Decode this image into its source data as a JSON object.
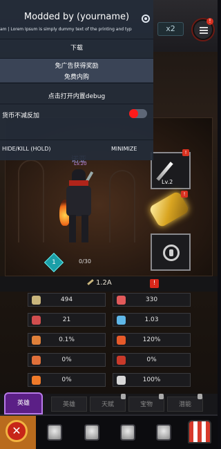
{
  "topbar": {
    "speed_label": "x2",
    "menu_badge": "!"
  },
  "hero": {
    "name": "诺亚",
    "level_tag": "Lv.20"
  },
  "stage": {
    "skill_points": "1",
    "progress": "0/30"
  },
  "equipment": {
    "weapon_level": "Lv.2",
    "weapon_badge": "!",
    "cannon_badge": "!"
  },
  "power": {
    "value": "1.2A",
    "warn_badge": "!"
  },
  "stats": [
    {
      "icon": "sword-icon",
      "value": "494"
    },
    {
      "icon": "heart-icon",
      "value": "330"
    },
    {
      "icon": "heart-shield-icon",
      "value": "21"
    },
    {
      "icon": "blue-sword-icon",
      "value": "1.03"
    },
    {
      "icon": "crit-icon",
      "value": "0.1%"
    },
    {
      "icon": "crit-damage-icon",
      "value": "120%"
    },
    {
      "icon": "arrow-icon",
      "value": "0%"
    },
    {
      "icon": "red-arrow-icon",
      "value": "0%"
    },
    {
      "icon": "fire-icon",
      "value": "0%"
    },
    {
      "icon": "skull-icon",
      "value": "100%"
    }
  ],
  "tabs": [
    {
      "label": "英雄",
      "active": true
    },
    {
      "label": "英雄",
      "active": false
    },
    {
      "label": "天赋",
      "active": false
    },
    {
      "label": "宝物",
      "active": false
    },
    {
      "label": "潜能",
      "active": false
    }
  ],
  "bottom_nav": {
    "close_glyph": "✕",
    "items": [
      "close-icon",
      "lock-icon",
      "lock-icon",
      "lock-icon",
      "lock-icon",
      "shop-icon"
    ]
  },
  "mod_menu": {
    "title": "Modded by (yourname)",
    "marquee": "am | Lorem Ipsum is simply dummy text of the printing and typ",
    "download_label": "下载",
    "ad_reward_label": "免广告获得奖励",
    "free_purchase_label": "免费内购",
    "debug_label": "点击打开内置debug",
    "toggle_label": "货币不减反加",
    "toggle_on": false,
    "hide_label": "HIDE/KILL (HOLD)",
    "minimize_label": "MINIMIZE"
  },
  "colors": {
    "mod_bg": "#242c3a",
    "toggle_knob": "#ff1a1a",
    "active_tab": "#5b1f86",
    "close_red": "#c72618"
  }
}
